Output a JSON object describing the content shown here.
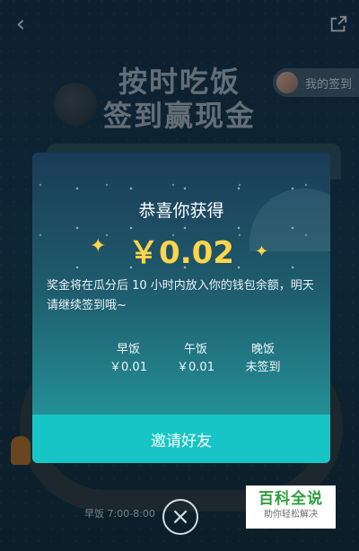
{
  "header": {
    "back_icon": "chevron-left-icon",
    "share_icon": "share-icon"
  },
  "hero": {
    "title_line1": "按时吃饭",
    "title_line2": "签到赢现金",
    "my_checkin_label": "我的签到"
  },
  "background": {
    "meal_time_label": "早饭 7:00-8:00"
  },
  "modal": {
    "heading": "恭喜你获得",
    "amount": "￥0.02",
    "description": "奖金将在瓜分后 10 小时内放入你的钱包余额，明天请继续签到哦~",
    "meals": [
      {
        "name": "早饭",
        "value": "￥0.01"
      },
      {
        "name": "午饭",
        "value": "￥0.01"
      },
      {
        "name": "晚饭",
        "value": "未签到"
      }
    ],
    "invite_button": "邀请好友",
    "close_icon": "close-icon"
  },
  "watermark": {
    "title": "百科全说",
    "subtitle": "助你轻松解决"
  },
  "colors": {
    "accent": "#17c5c6",
    "amount": "#ffd54a"
  }
}
